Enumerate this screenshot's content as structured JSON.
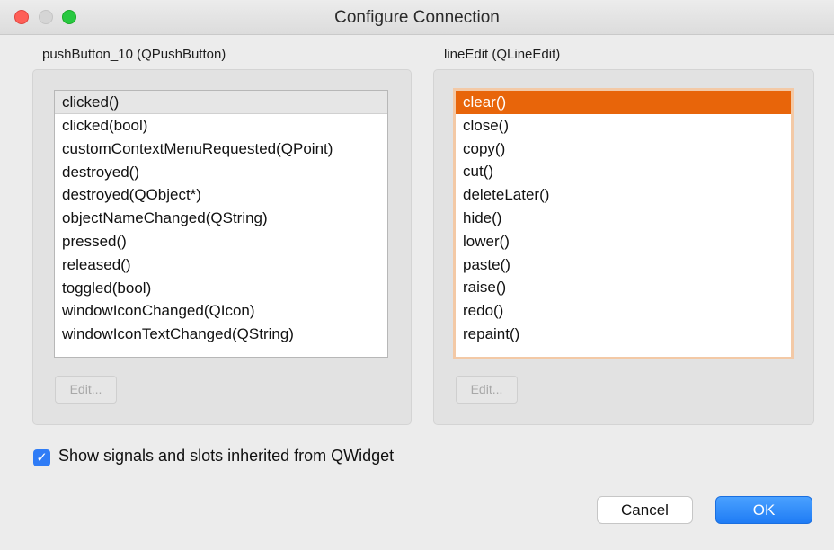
{
  "window": {
    "title": "Configure Connection"
  },
  "left": {
    "label": "pushButton_10 (QPushButton)",
    "items": [
      "clicked()",
      "clicked(bool)",
      "customContextMenuRequested(QPoint)",
      "destroyed()",
      "destroyed(QObject*)",
      "objectNameChanged(QString)",
      "pressed()",
      "released()",
      "toggled(bool)",
      "windowIconChanged(QIcon)",
      "windowIconTextChanged(QString)"
    ],
    "selected": "clicked()",
    "edit_label": "Edit..."
  },
  "right": {
    "label": "lineEdit (QLineEdit)",
    "items": [
      "clear()",
      "close()",
      "copy()",
      "cut()",
      "deleteLater()",
      "hide()",
      "lower()",
      "paste()",
      "raise()",
      "redo()",
      "repaint()"
    ],
    "selected": "clear()",
    "edit_label": "Edit..."
  },
  "options": {
    "inherited_label": "Show signals and slots inherited from QWidget",
    "inherited_checked": true
  },
  "buttons": {
    "cancel": "Cancel",
    "ok": "OK"
  },
  "colors": {
    "selection": "#e8650a",
    "accent": "#1f7cf5"
  }
}
